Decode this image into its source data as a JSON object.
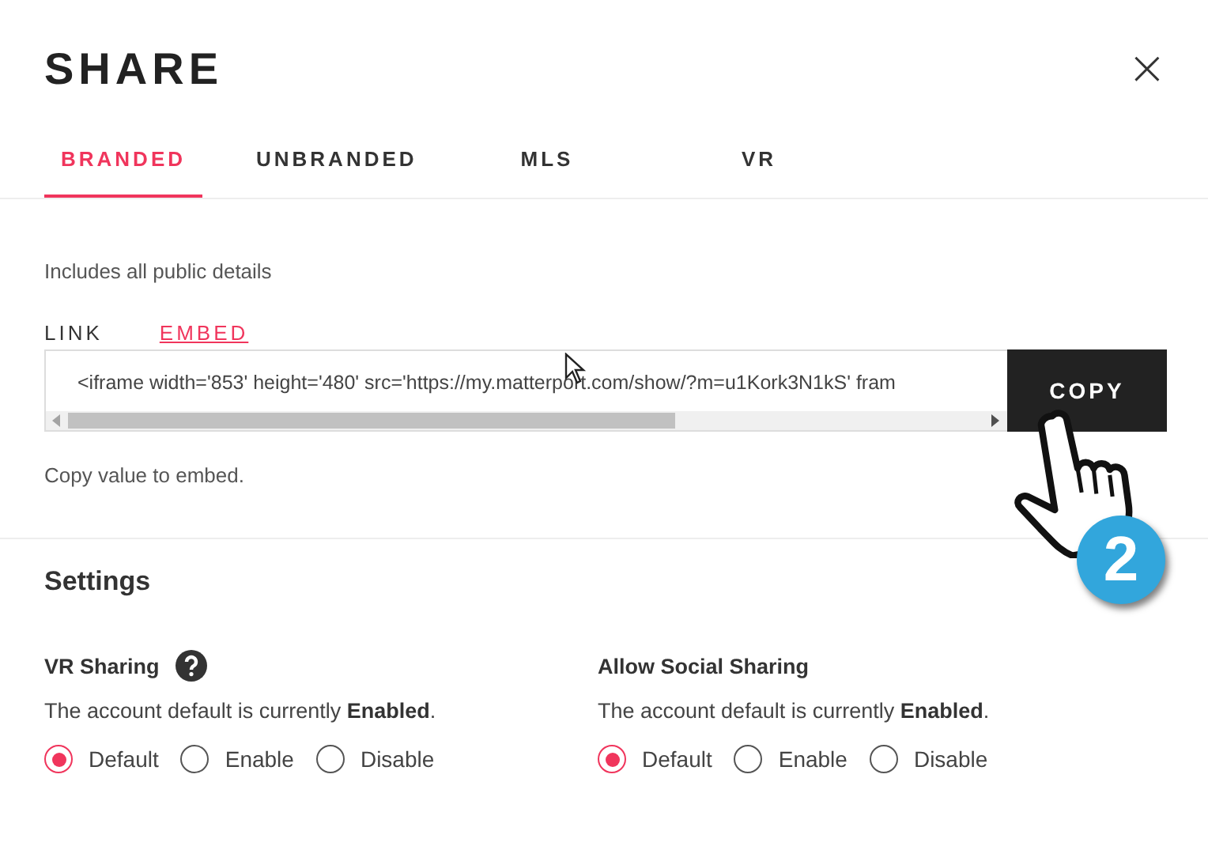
{
  "dialog": {
    "title": "SHARE",
    "close": "×"
  },
  "tabs": [
    {
      "label": "BRANDED",
      "selected": true
    },
    {
      "label": "UNBRANDED",
      "selected": false
    },
    {
      "label": "MLS",
      "selected": false
    },
    {
      "label": "VR",
      "selected": false
    }
  ],
  "description": "Includes all public details",
  "mode_links": [
    {
      "label": "LINK",
      "selected": false
    },
    {
      "label": "EMBED",
      "selected": true
    }
  ],
  "embed_field": {
    "value": "<iframe width='853' height='480' src='https://my.matterport.com/show/?m=u1Kork3N1kS' fram"
  },
  "copy_button": "COPY",
  "hint": "Copy value to embed.",
  "settings": {
    "title": "Settings",
    "groups": [
      {
        "label": "VR Sharing",
        "help": true,
        "note": "The account default is currently **Enabled**.",
        "options": [
          {
            "label": "Default",
            "selected": true
          },
          {
            "label": "Enable",
            "selected": false
          },
          {
            "label": "Disable",
            "selected": false
          }
        ]
      },
      {
        "label": "Allow Social Sharing",
        "help": false,
        "note": "The account default is currently **Enabled**.",
        "options": [
          {
            "label": "Default",
            "selected": true
          },
          {
            "label": "Enable",
            "selected": false
          },
          {
            "label": "Disable",
            "selected": false
          }
        ]
      }
    ]
  },
  "step_badge": "2"
}
